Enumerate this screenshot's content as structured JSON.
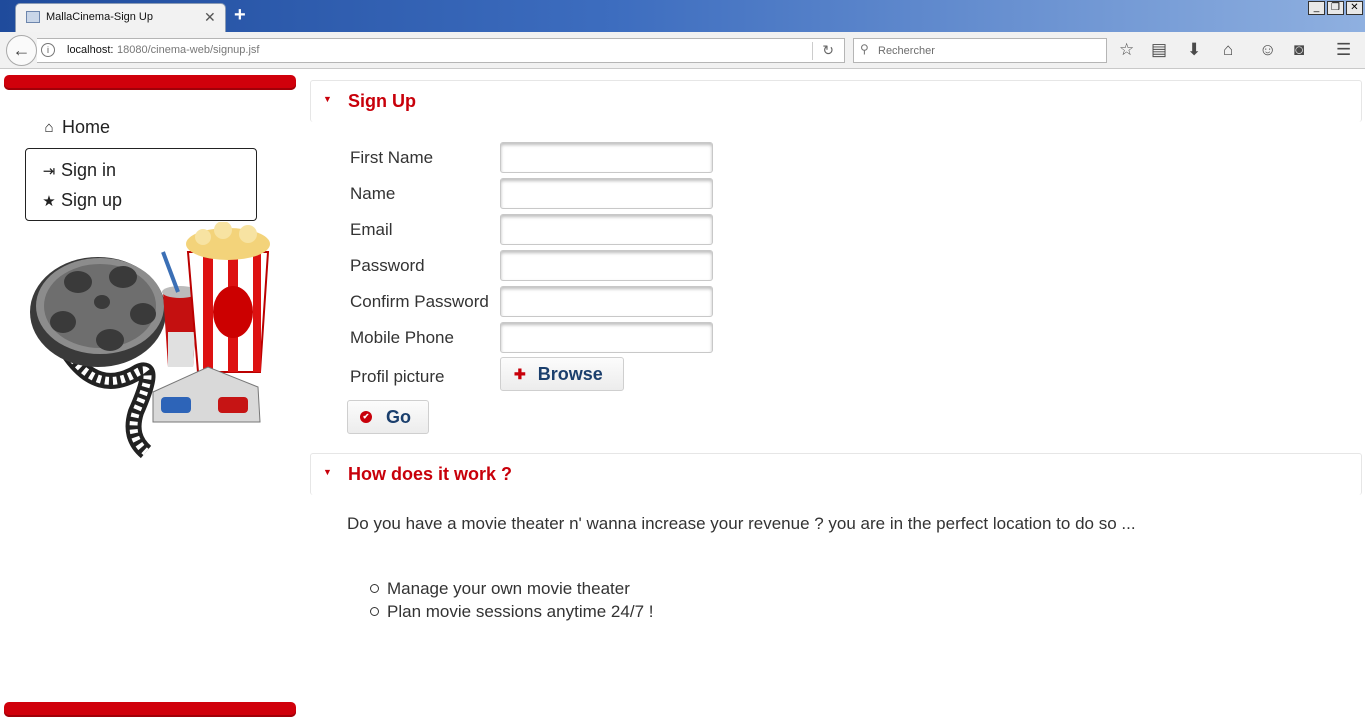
{
  "browser": {
    "tab_title": "MallaCinema-Sign Up",
    "url_host": "localhost:",
    "url_path": "18080/cinema-web/signup.jsf",
    "search_placeholder": "Rechercher"
  },
  "sidebar": {
    "home": "Home",
    "sign_in": "Sign in",
    "sign_up": "Sign up"
  },
  "signup_panel": {
    "title": "Sign Up",
    "fields": [
      {
        "label": "First Name",
        "value": ""
      },
      {
        "label": "Name",
        "value": ""
      },
      {
        "label": "Email",
        "value": ""
      },
      {
        "label": "Password",
        "value": ""
      },
      {
        "label": "Confirm Password",
        "value": ""
      },
      {
        "label": "Mobile Phone",
        "value": ""
      }
    ],
    "picture_label": "Profil picture",
    "browse_label": "Browse",
    "go_label": "Go"
  },
  "info_panel": {
    "title": "How does it work ?",
    "intro": "Do you have a movie theater n' wanna increase your revenue ? you are in the perfect location to do so ...",
    "features": [
      "Manage your own movie theater",
      "Plan movie sessions anytime 24/7 !"
    ]
  },
  "colors": {
    "accent_red": "#c8000a",
    "button_text": "#1b3f6d"
  }
}
